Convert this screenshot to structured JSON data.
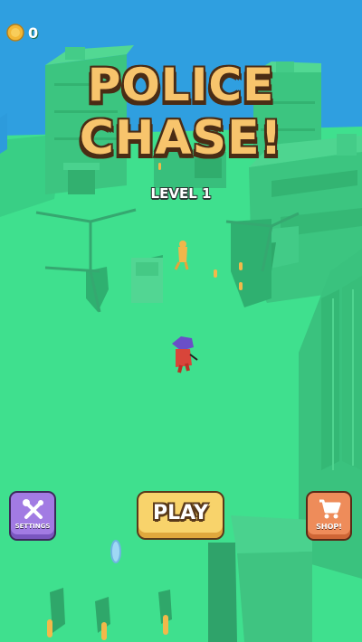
{
  "hud": {
    "coins": "0",
    "coin_icon": "gold-coin-icon"
  },
  "title": {
    "line1": "POLICE",
    "line2": "CHASE!"
  },
  "level": {
    "label": "LEVEL 1"
  },
  "buttons": {
    "settings": {
      "label": "SETTINGS",
      "icon": "wrench-screwdriver-icon"
    },
    "play": {
      "label": "PLAY"
    },
    "shop": {
      "label": "SHOP!",
      "icon": "shopping-cart-icon"
    }
  },
  "colors": {
    "sky": "#2f9fe0",
    "ground": "#3fe08e",
    "building": "#39c47e",
    "title_fill": "#f7c46c",
    "title_outline": "#4a2c15",
    "settings_button": "#a27be3",
    "play_button": "#f8d36b",
    "shop_button": "#ee8c5a",
    "player": "#d8453a",
    "player_head": "#6a4fc7",
    "suspect": "#f2b64a"
  }
}
